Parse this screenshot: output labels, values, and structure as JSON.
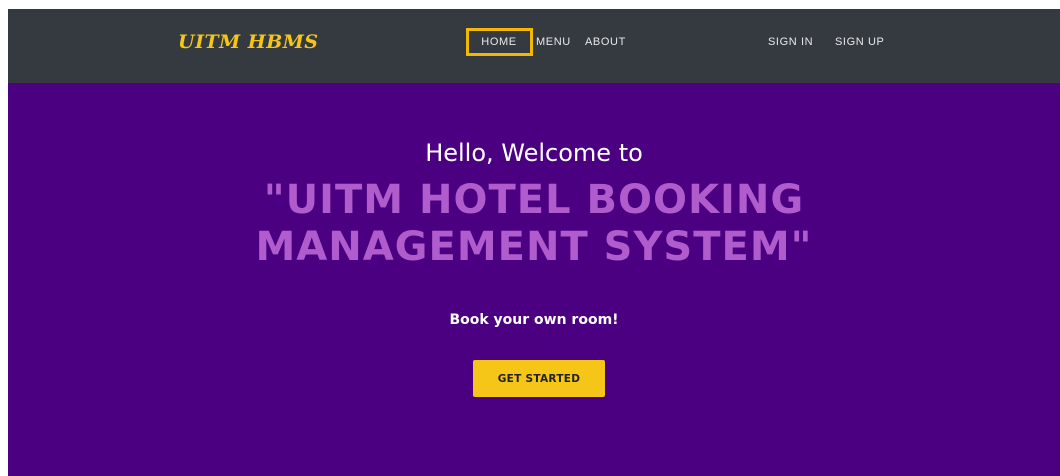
{
  "navbar": {
    "brand": "UITM HBMS",
    "links": [
      "HOME",
      "MENU",
      "ABOUT"
    ],
    "auth": {
      "sign_in": "SIGN IN",
      "sign_up": "SIGN UP"
    }
  },
  "hero": {
    "greeting": "Hello, Welcome to",
    "headline_line1": "\"UITM HOTEL BOOKING",
    "headline_line2": "MANAGEMENT SYSTEM\"",
    "tagline": "Book your own room!",
    "cta_label": "GET STARTED"
  },
  "colors": {
    "navbar_bg": "#343a40",
    "hero_bg": "#4b0082",
    "accent": "#f5c518",
    "headline": "#b05ccd"
  }
}
